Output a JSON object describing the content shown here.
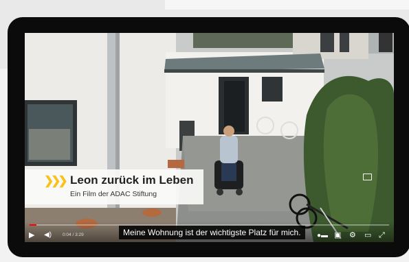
{
  "video": {
    "title": "Leon zurück im Leben",
    "subtitle_line": "Ein Film der ADAC Stiftung",
    "caption": "Meine Wohnung ist der wichtigste Platz für mich.",
    "time": "0:04 / 3:29",
    "progress": 0.02
  },
  "colors": {
    "accent": "#f7c21b",
    "progress": "#ff0000"
  },
  "icons": [
    "play-icon",
    "volume-icon",
    "autoplay-toggle-icon",
    "subtitles-icon",
    "settings-icon",
    "miniplayer-icon",
    "fullscreen-icon",
    "captions-badge-icon"
  ]
}
